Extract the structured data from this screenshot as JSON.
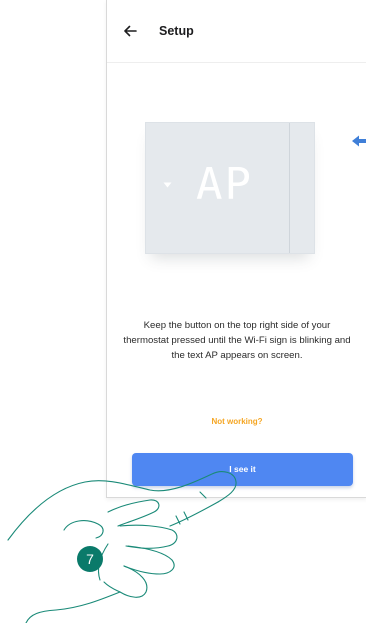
{
  "header": {
    "title": "Setup"
  },
  "thermostat": {
    "display_text": "AP"
  },
  "instructions": {
    "text": "Keep the button on the top right side of your thermostat pressed until the Wi-Fi sign is blinking and the text AP appears on screen."
  },
  "help_link": {
    "label": "Not working?"
  },
  "primary_button": {
    "label": "I see it"
  },
  "step": {
    "number": "7"
  },
  "colors": {
    "accent": "#4f87f2",
    "link": "#f5a623",
    "step_badge": "#0a7a6a",
    "thermostat_body": "#e5e9ed"
  }
}
